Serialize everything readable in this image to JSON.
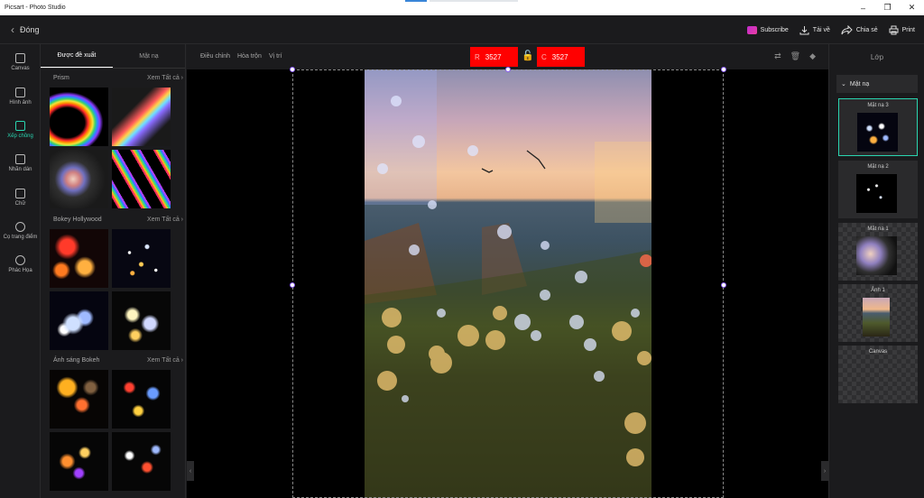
{
  "window": {
    "title": "Picsart - Photo Studio",
    "controls": [
      "–",
      "❐",
      "✕"
    ]
  },
  "topbar": {
    "back_label": "Đóng",
    "subscribe_label": "Subscribe",
    "download_label": "Tải về",
    "share_label": "Chia sẻ",
    "print_label": "Print"
  },
  "rail": {
    "items": [
      {
        "label": "Canvas",
        "icon": "canvas-icon"
      },
      {
        "label": "Hình ảnh",
        "icon": "image-icon"
      },
      {
        "label": "Xếp chồng",
        "icon": "overlay-icon",
        "active": true
      },
      {
        "label": "Nhãn dán",
        "icon": "sticker-icon"
      },
      {
        "label": "Chữ",
        "icon": "text-icon"
      },
      {
        "label": "Cọ trang điểm",
        "icon": "brush-icon"
      },
      {
        "label": "Phác Họa",
        "icon": "sketch-icon"
      }
    ]
  },
  "left_panel": {
    "tabs": [
      "Được đề xuất",
      "Mặt nạ"
    ],
    "active_tab": 0,
    "sections": [
      {
        "title": "Prism",
        "see_all": "Xem Tất cả"
      },
      {
        "title": "Bokey Hollywood",
        "see_all": "Xem Tất cả"
      },
      {
        "title": "Ánh sáng Bokeh",
        "see_all": "Xem Tất cả"
      }
    ]
  },
  "canvas_toolbar": {
    "tools": [
      "Điều chỉnh",
      "Hòa trộn",
      "Vị trí"
    ],
    "width_label": "R",
    "width_value": "3527",
    "height_label": "C",
    "height_value": "3527"
  },
  "layers_panel": {
    "title": "Lớp",
    "group_name": "Mặt nạ",
    "layers": [
      {
        "name": "Mặt nạ 3",
        "active": true
      },
      {
        "name": "Mặt nạ 2",
        "active": false
      },
      {
        "name": "Mặt nạ 1",
        "active": false
      },
      {
        "name": "Ảnh 1",
        "active": false
      },
      {
        "name": "Canvas",
        "active": false
      }
    ]
  }
}
